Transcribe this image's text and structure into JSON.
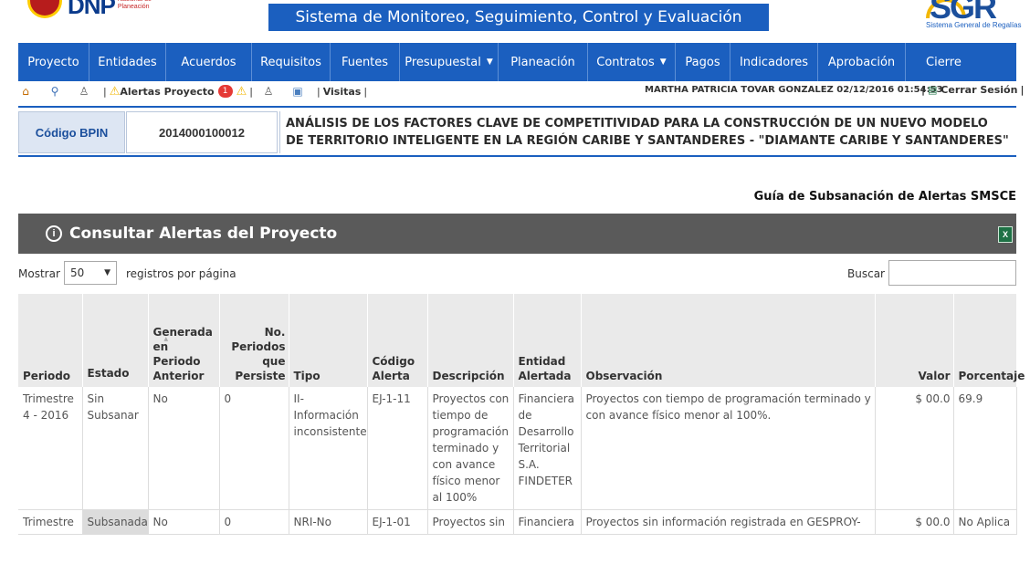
{
  "header": {
    "dnp_logo": "DNP",
    "dnp_logo_sub": "Nacional de Planeación",
    "title": "Sistema de Monitoreo, Seguimiento, Control y Evaluación",
    "sgr_logo": "SGR",
    "sgr_logo_sub": "Sistema General de Regalías"
  },
  "nav": [
    {
      "label": "Proyecto"
    },
    {
      "label": "Entidades"
    },
    {
      "label": "Acuerdos"
    },
    {
      "label": "Requisitos"
    },
    {
      "label": "Fuentes"
    },
    {
      "label": "Presupuestal",
      "dropdown": true
    },
    {
      "label": "Planeación"
    },
    {
      "label": "Contratos",
      "dropdown": true
    },
    {
      "label": "Pagos"
    },
    {
      "label": "Indicadores"
    },
    {
      "label": "Aprobación"
    },
    {
      "label": "Cierre"
    }
  ],
  "toolbar": {
    "alerts_label": "Alertas Proyecto",
    "alerts_count": "1",
    "visits_label": "Visitas",
    "user": "MARTHA PATRICIA TOVAR GONZALEZ 02/12/2016 01:54:53",
    "logout": "Cerrar Sesión"
  },
  "project": {
    "bpin_label": "Código BPIN",
    "bpin_value": "2014000100012",
    "name": "ANÁLISIS DE LOS FACTORES CLAVE DE COMPETITIVIDAD PARA LA CONSTRUCCIÓN DE UN NUEVO MODELO DE TERRITORIO INTELIGENTE EN LA REGIÓN CARIBE Y SANTANDERES - \"DIAMANTE CARIBE Y SANTANDERES\""
  },
  "guide_link": "Guía de Subsanación de Alertas SMSCE",
  "panel": {
    "title": "Consultar Alertas del Proyecto"
  },
  "controls": {
    "show_label": "Mostrar",
    "page_size": "50",
    "per_page_label": "registros por página",
    "search_label": "Buscar",
    "search_value": ""
  },
  "table": {
    "columns": [
      "Periodo",
      "Estado",
      "Generada en Periodo Anterior",
      "No. Periodos que Persiste",
      "Tipo",
      "Código Alerta",
      "Descripción",
      "Entidad Alertada",
      "Observación",
      "Valor",
      "Porcentaje"
    ],
    "rows": [
      {
        "periodo": "Trimestre 4 - 2016",
        "estado": "Sin Subsanar",
        "generada": "No",
        "periodos": "0",
        "tipo": "II- Información inconsistente",
        "codigo": "EJ-1-11",
        "descripcion": "Proyectos con tiempo de programación terminado y con avance físico menor al 100%",
        "entidad": "Financiera de Desarrollo Territorial S.A. FINDETER",
        "observacion": "Proyectos con tiempo de programación terminado y con avance físico menor al 100%.",
        "valor": "$ 00.0",
        "porcentaje": "69.9"
      },
      {
        "periodo": "Trimestre",
        "estado": "Subsanada",
        "generada": "No",
        "periodos": "0",
        "tipo": "NRI-No",
        "codigo": "EJ-1-01",
        "descripcion": "Proyectos sin",
        "entidad": "Financiera",
        "observacion": "Proyectos sin información registrada en GESPROY-",
        "valor": "$ 00.0",
        "porcentaje": "No Aplica"
      }
    ]
  },
  "colors": {
    "nav_blue": "#1b5fbf",
    "panel_gray": "#5a5a5a",
    "header_gray": "#eaeaea",
    "alert_red": "#e53935",
    "warning_yellow": "#f2b705"
  }
}
